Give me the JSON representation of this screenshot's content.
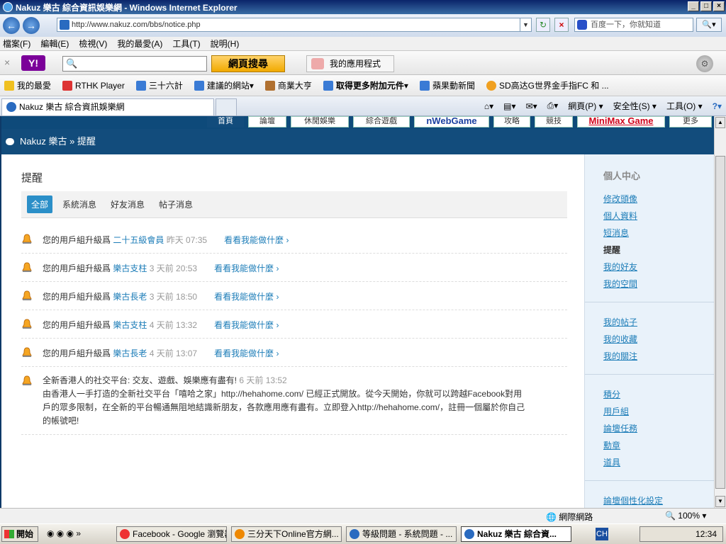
{
  "window": {
    "title": "Nakuz 樂古 綜合資訊娛樂網 - Windows Internet Explorer"
  },
  "address": {
    "url": "http://www.nakuz.com/bbs/notice.php",
    "search_placeholder": "百度一下，你就知道"
  },
  "menu": [
    "檔案(F)",
    "編輯(E)",
    "檢視(V)",
    "我的最愛(A)",
    "工具(T)",
    "說明(H)"
  ],
  "yahoo": {
    "search_button": "網頁搜尋",
    "apps_label": "我的應用程式"
  },
  "favorites": [
    "我的最愛",
    "RTHK Player",
    "三十六計",
    "建議的網站",
    "商業大亨",
    "取得更多附加元件",
    "蘋果動新聞",
    "SD高达G世界金手指FC 和 ..."
  ],
  "tab": {
    "label": "Nakuz 樂古 綜合資訊娛樂網"
  },
  "tools": {
    "page": "網頁(P)",
    "safety": "安全性(S)",
    "tools": "工具(O)"
  },
  "topnav": [
    "首頁",
    "論壇",
    "休閒娛樂",
    "綜合遊戲",
    "nWebGame",
    "攻略",
    "競技",
    "MiniMax Game",
    "更多"
  ],
  "breadcrumb": "Nakuz 樂古 » 提醒",
  "page": {
    "title": "提醒"
  },
  "filters": [
    "全部",
    "系統消息",
    "好友消息",
    "帖子消息"
  ],
  "notices": [
    {
      "prefix": "您的用戶組升級爲",
      "group": "二十五級會員",
      "time": "昨天 07:35",
      "link": "看看我能做什麼"
    },
    {
      "prefix": "您的用戶組升級爲",
      "group": "樂古支柱",
      "time": "3 天前 20:53",
      "link": "看看我能做什麼"
    },
    {
      "prefix": "您的用戶組升級爲",
      "group": "樂古長老",
      "time": "3 天前 18:50",
      "link": "看看我能做什麼"
    },
    {
      "prefix": "您的用戶組升級爲",
      "group": "樂古支柱",
      "time": "4 天前 13:32",
      "link": "看看我能做什麼"
    },
    {
      "prefix": "您的用戶組升級爲",
      "group": "樂古長老",
      "time": "4 天前 13:07",
      "link": "看看我能做什麼"
    }
  ],
  "announcement": {
    "title": "全新香港人的社交平台: 交友、遊戲、娛樂應有盡有!",
    "time": "6 天前 13:52",
    "line1": "由香港人一手打造的全新社交平台「嘻哈之家」http://hehahome.com/ 已經正式開放。從今天開始，你就可以跨越Facebook對用",
    "line2": "戶的眾多限制，在全新的平台暢通無阻地結識新朋友，各款應用應有盡有。立即登入http://hehahome.com/，註冊一個屬於你自己",
    "line3": "的帳號吧!"
  },
  "sidebar": {
    "title": "個人中心",
    "group1": [
      "修改頭像",
      "個人資料",
      "短消息",
      "提醒",
      "我的好友",
      "我的空間"
    ],
    "group2": [
      "我的帖子",
      "我的收藏",
      "我的關注"
    ],
    "group3": [
      "積分",
      "用戶組",
      "論壇任務",
      "勳章",
      "道具"
    ],
    "group4": [
      "論壇個性化設定"
    ]
  },
  "status": {
    "zone": "網際網路",
    "zoom": "100%"
  },
  "taskbar": {
    "start": "開始",
    "items": [
      "Facebook - Google 瀏覽器",
      "三分天下Online官方網...",
      "等級問題 - 系統問題 - ...",
      "Nakuz 樂古 綜合資..."
    ],
    "clock": "12:34",
    "lang": "CH"
  }
}
